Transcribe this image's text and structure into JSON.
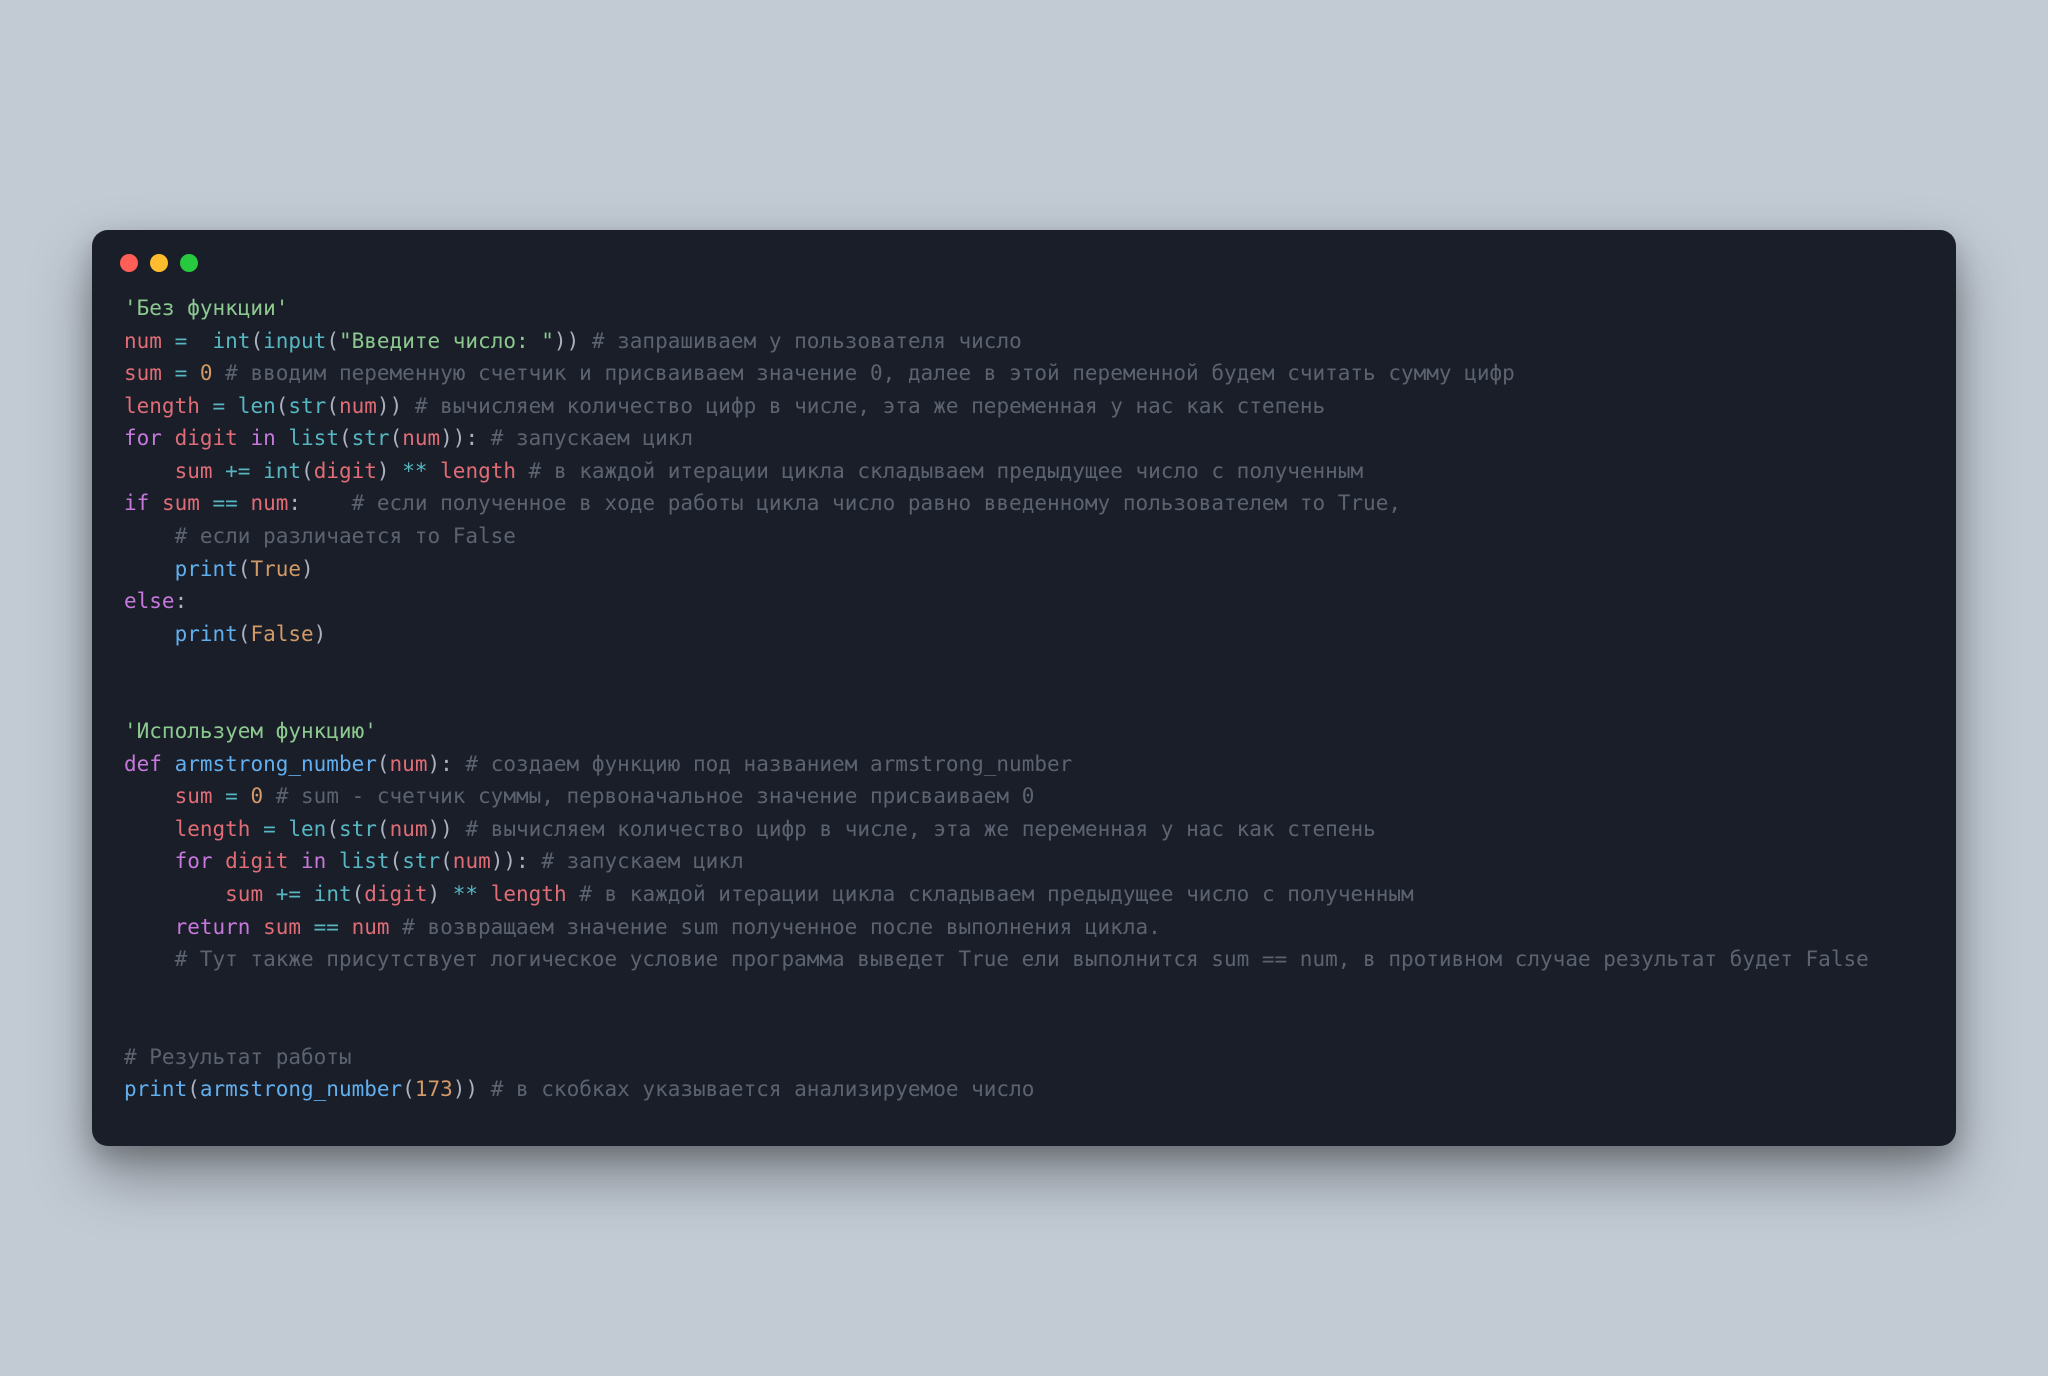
{
  "traffic": {
    "close": "close-window",
    "min": "minimize-window",
    "max": "maximize-window"
  },
  "c": {
    "l01_str": "'Без функции'",
    "l02_num": "num",
    "l02_eq": " =  ",
    "l02_int": "int",
    "l02_lp": "(",
    "l02_input": "input",
    "l02_lp2": "(",
    "l02_prompt": "\"Введите число: \"",
    "l02_rp": "))",
    "l02_cmt": " # запрашиваем у пользователя число",
    "l03_sum": "sum",
    "l03_eq": " = ",
    "l03_zero": "0",
    "l03_cmt": " # вводим переменную счетчик и присваиваем значение 0, далее в этой переменной будем считать сумму цифр",
    "l04_len": "length",
    "l04_eq": " = ",
    "l04_lenfn": "len",
    "l04_lp": "(",
    "l04_str": "str",
    "l04_lp2": "(",
    "l04_num": "num",
    "l04_rp": "))",
    "l04_cmt": " # вычисляем количество цифр в числе, эта же переменная у нас как степень",
    "l05_for": "for",
    "l05_digit": " digit ",
    "l05_in": "in",
    "l05_list": " list",
    "l05_lp": "(",
    "l05_str": "str",
    "l05_lp2": "(",
    "l05_num": "num",
    "l05_rp": ")):",
    "l05_cmt": " # запускаем цикл",
    "l06_ind": "    ",
    "l06_sum": "sum",
    "l06_pe": " += ",
    "l06_int": "int",
    "l06_lp": "(",
    "l06_digit": "digit",
    "l06_rp": ") ",
    "l06_pow": "**",
    "l06_sp": " ",
    "l06_len": "length",
    "l06_cmt": " # в каждой итерации цикла складываем предыдущее число с полученным",
    "l07_if": "if",
    "l07_sum": " sum ",
    "l07_eq": "==",
    "l07_num": " num",
    "l07_col": ":   ",
    "l07_cmt": " # если полученное в ходе работы цикла число равно введенному пользователем то True,",
    "l08": "    # если различается то False",
    "l09_ind": "    ",
    "l09_print": "print",
    "l09_lp": "(",
    "l09_true": "True",
    "l09_rp": ")",
    "l10_else": "else",
    "l10_col": ":",
    "l11_ind": "    ",
    "l11_print": "print",
    "l11_lp": "(",
    "l11_false": "False",
    "l11_rp": ")",
    "gap": "",
    "l13_str": "'Используем функцию'",
    "l14_def": "def",
    "l14_name": " armstrong_number",
    "l14_lp": "(",
    "l14_arg": "num",
    "l14_rp": "):",
    "l14_cmt": " # создаем функцию под названием armstrong_number",
    "l15_ind": "    ",
    "l15_sum": "sum",
    "l15_eq": " = ",
    "l15_zero": "0",
    "l15_cmt": " # sum - счетчик суммы, первоначальное значение присваиваем 0",
    "l16_ind": "    ",
    "l16_len": "length",
    "l16_eq": " = ",
    "l16_lenfn": "len",
    "l16_lp": "(",
    "l16_str": "str",
    "l16_lp2": "(",
    "l16_num": "num",
    "l16_rp": "))",
    "l16_cmt": " # вычисляем количество цифр в числе, эта же переменная у нас как степень",
    "l17_ind": "    ",
    "l17_for": "for",
    "l17_digit": " digit ",
    "l17_in": "in",
    "l17_list": " list",
    "l17_lp": "(",
    "l17_str": "str",
    "l17_lp2": "(",
    "l17_num": "num",
    "l17_rp": ")):",
    "l17_cmt": " # запускаем цикл",
    "l18_ind": "        ",
    "l18_sum": "sum",
    "l18_pe": " += ",
    "l18_int": "int",
    "l18_lp": "(",
    "l18_digit": "digit",
    "l18_rp": ") ",
    "l18_pow": "**",
    "l18_sp": " ",
    "l18_len": "length",
    "l18_cmt": " # в каждой итерации цикла складываем предыдущее число с полученным",
    "l19_ind": "    ",
    "l19_ret": "return",
    "l19_sum": " sum ",
    "l19_eq": "==",
    "l19_num": " num",
    "l19_cmt": " # возвращаем значение sum полученное после выполнения цикла.",
    "l20": "    # Тут также присутствует логическое условие программа выведет True ели выполнится sum == num, в противном случае результат будет False",
    "l22": "# Результат работы",
    "l23_print": "print",
    "l23_lp": "(",
    "l23_fn": "armstrong_number",
    "l23_lp2": "(",
    "l23_arg": "173",
    "l23_rp": "))",
    "l23_cmt": " # в скобках указывается анализируемое число"
  }
}
